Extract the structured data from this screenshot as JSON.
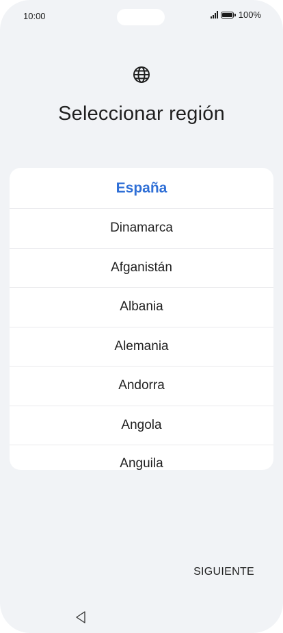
{
  "status_bar": {
    "time": "10:00",
    "battery": "100%"
  },
  "header": {
    "title": "Seleccionar región",
    "icon": "globe-icon"
  },
  "regions": {
    "selected": "España",
    "items": [
      "Dinamarca",
      "Afganistán",
      "Albania",
      "Alemania",
      "Andorra",
      "Angola",
      "Anguila"
    ]
  },
  "footer": {
    "next_label": "SIGUIENTE"
  },
  "colors": {
    "background": "#f1f3f6",
    "accent": "#2f6fd6",
    "text": "#1f1f1f"
  }
}
